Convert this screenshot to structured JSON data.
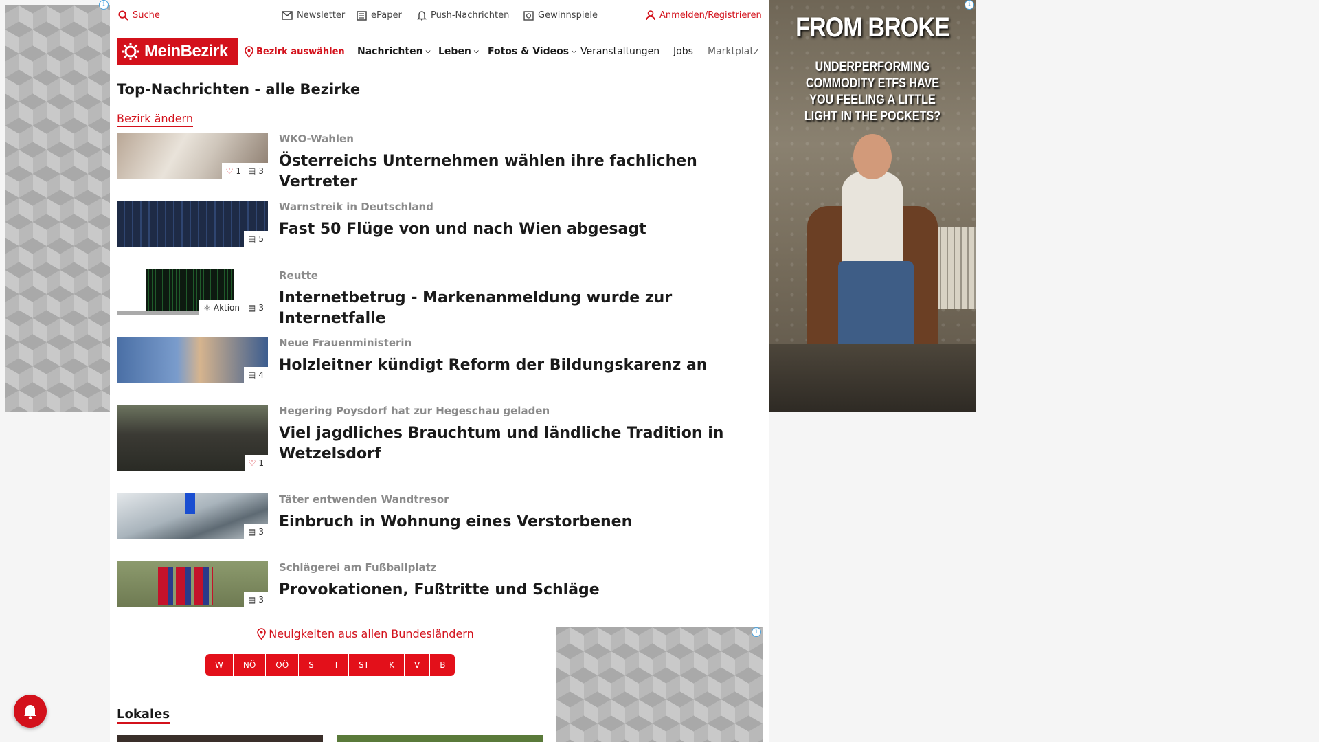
{
  "topbar": {
    "search": "Suche",
    "newsletter": "Newsletter",
    "epaper": "ePaper",
    "push": "Push-Nachrichten",
    "gewinnspiele": "Gewinnspiele",
    "login": "Anmelden/Registrieren"
  },
  "nav": {
    "logo": "MeinBezirk",
    "select_district": "Bezirk auswählen",
    "items": [
      "Nachrichten",
      "Leben",
      "Fotos & Videos",
      "Veranstaltungen",
      "Jobs",
      "Marktplatz"
    ]
  },
  "main": {
    "title": "Top-Nachrichten - alle Bezirke",
    "change_district": "Bezirk ändern",
    "articles": [
      {
        "kicker": "WKO-Wahlen",
        "headline": "Österreichs Unternehmen wählen ihre fachlichen Vertreter",
        "likes": "1",
        "images": "3"
      },
      {
        "kicker": "Warnstreik in Deutschland",
        "headline": "Fast 50 Flüge von und nach Wien abgesagt",
        "images": "5"
      },
      {
        "kicker": "Reutte",
        "headline": "Internetbetrug - Markenanmeldung wurde zur Internetfalle",
        "action": "Aktion",
        "images": "3"
      },
      {
        "kicker": "Neue Frauenministerin",
        "headline": "Holzleitner kündigt Reform der Bildungskarenz an",
        "images": "4"
      },
      {
        "kicker": "Hegering Poysdorf hat zur Hegeschau geladen",
        "headline": "Viel jagdliches Brauchtum und ländliche Tradition in Wetzelsdorf",
        "likes": "1"
      },
      {
        "kicker": "Täter entwenden Wandtresor",
        "headline": "Einbruch in Wohnung eines Verstorbenen",
        "images": "3"
      },
      {
        "kicker": "Schlägerei am Fußballplatz",
        "headline": "Provokationen, Fußtritte und Schläge",
        "images": "3"
      }
    ],
    "bundeslaender_title": "Neuigkeiten aus allen Bundesländern",
    "states": [
      "W",
      "NÖ",
      "OÖ",
      "S",
      "T",
      "ST",
      "K",
      "V",
      "B"
    ],
    "lokales": "Lokales"
  },
  "ad_right": {
    "headline": "FROM BROKE ...",
    "text": "UNDERPERFORMING COMMODITY ETFS HAVE YOU FEELING A LITTLE LIGHT IN THE POCKETS?"
  },
  "colors": {
    "brand_red": "#d3111b"
  }
}
